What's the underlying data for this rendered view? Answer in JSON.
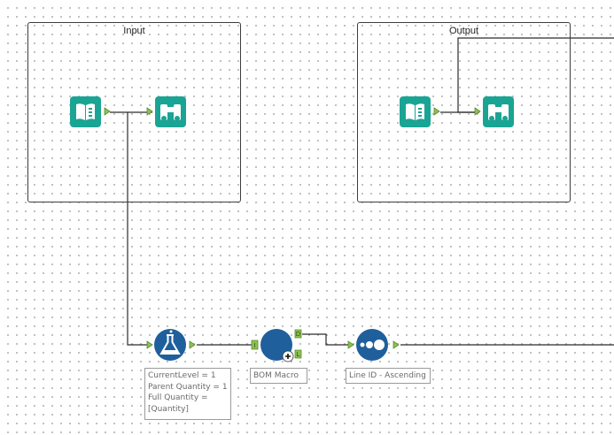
{
  "canvas": {
    "containers": {
      "input": {
        "title": "Input"
      },
      "output": {
        "title": "Output"
      }
    },
    "tools": {
      "input_data": {
        "icon": "book-input-icon"
      },
      "browse_input": {
        "icon": "binoculars-icon"
      },
      "output_data": {
        "icon": "book-input-icon"
      },
      "browse_output": {
        "icon": "binoculars-icon"
      },
      "formula": {
        "icon": "flask-icon",
        "annotation": [
          "CurrentLevel = 1",
          "Parent Quantity = 1",
          "Full Quantity =",
          "[Quantity]"
        ]
      },
      "macro": {
        "icon": "macro-circle-icon",
        "annotation": "BOM Macro",
        "anchor_top": "D",
        "anchor_bottom": "L",
        "anchor_in": "I"
      },
      "record_id": {
        "icon": "record-id-icon",
        "annotation": "Line ID - Ascending"
      }
    },
    "colors": {
      "tool_teal": "#1aa493",
      "tool_blue": "#1f5f9c",
      "anchor_green": "#8cc152",
      "wire": "#2b2b2b"
    }
  }
}
